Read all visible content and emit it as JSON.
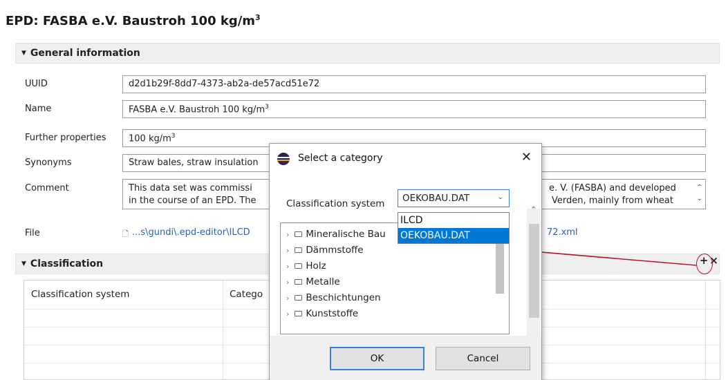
{
  "page": {
    "title": "EPD: FASBA e.V. Baustroh 100 kg/m",
    "title_sup": "3"
  },
  "general": {
    "header": "General information",
    "fields": {
      "uuid_label": "UUID",
      "uuid_value": "d2d1b29f-8dd7-4373-ab2a-de57acd51e72",
      "name_label": "Name",
      "name_value": "FASBA e.V. Baustroh 100 kg/m",
      "name_sup": "3",
      "further_label": "Further properties",
      "further_value": "100 kg/m",
      "further_sup": "3",
      "synonyms_label": "Synonyms",
      "synonyms_value": "Straw bales, straw insulation",
      "comment_label": "Comment",
      "comment_line1_left": "This data set was commissi",
      "comment_line1_right": "e. V. (FASBA) and developed",
      "comment_line2_left": "in the course of an EPD. The",
      "comment_line2_right": "Verden, mainly from wheat",
      "file_label": "File",
      "file_left": "...s\\gundi\\.epd-editor\\ILCD",
      "file_right": "72.xml"
    }
  },
  "classification": {
    "header": "Classification",
    "add_icon": "plus-icon",
    "remove_icon": "close-icon",
    "col_system": "Classification system",
    "col_category": "Catego"
  },
  "dialog": {
    "title": "Select a category",
    "system_label": "Classification system",
    "selected_value": "OEKOBAU.DAT",
    "options": [
      "ILCD",
      "OEKOBAU.DAT"
    ],
    "tree_items": [
      "Mineralische Bau",
      "Dämmstoffe",
      "Holz",
      "Metalle",
      "Beschichtungen",
      "Kunststoffe"
    ],
    "ok_label": "OK",
    "cancel_label": "Cancel"
  },
  "colors": {
    "accent": "#0078d7",
    "link": "#1f63c4",
    "annotation": "#b3152b"
  }
}
